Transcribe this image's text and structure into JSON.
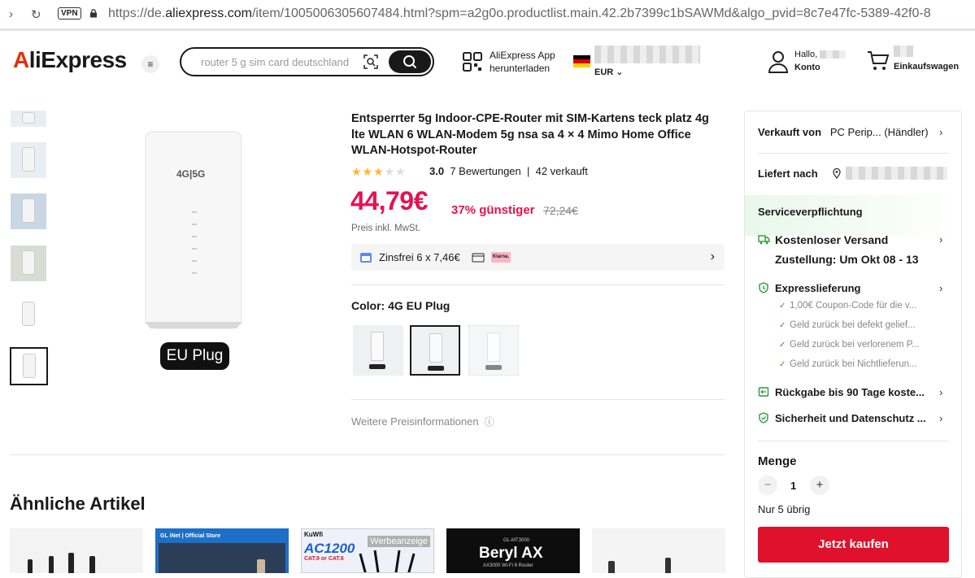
{
  "browser": {
    "vpn_label": "VPN",
    "url_prefix": "https://de.",
    "url_domain": "aliexpress.com",
    "url_rest": "/item/1005006305607484.html?spm=a2g0o.productlist.main.42.2b7399c1bSAWMd&algo_pvid=8c7e47fc-5389-42f0-8"
  },
  "header": {
    "logo": "AliExpress",
    "search_placeholder": "router 5 g sim card deutschland",
    "app_line1": "AliExpress App",
    "app_line2": "herunterladen",
    "currency": "EUR",
    "hello": "Hallo,",
    "account": "Konto",
    "cart": "Einkaufswagen"
  },
  "gallery": {
    "main_badge": "EU Plug"
  },
  "product": {
    "title": "Entsperrter 5g Indoor-CPE-Router mit SIM-Kartens teck platz 4g lte WLAN 6 WLAN-Modem 5g nsa sa 4 × 4 Mimo Home Office WLAN-Hotspot-Router",
    "rating": "3.0",
    "reviews": "7 Bewertungen",
    "sold": "42 verkauft",
    "price": "44,79€",
    "discount": "37% günstiger",
    "old_price": "72,24€",
    "tax_note": "Preis inkl. MwSt.",
    "installment": "Zinsfrei 6 x 7,46€",
    "klarna": "Klarna.",
    "color_label": "Color: 4G EU Plug",
    "more_info": "Weitere Preisinformationen"
  },
  "panel": {
    "sold_by_label": "Verkauft von",
    "sold_by_value": "PC Perip... (Händler)",
    "ship_to_label": "Liefert nach",
    "service_heading": "Serviceverpflichtung",
    "free_shipping": "Kostenloser Versand",
    "delivery": "Zustellung: Um Okt 08 - 13",
    "express": "Expresslieferung",
    "express_items": [
      "1,00€ Coupon-Code für die v...",
      "Geld zurück bei defekt gelief...",
      "Geld zurück bei verlorenem P...",
      "Geld zurück bei Nichtlieferun..."
    ],
    "returns": "Rückgabe bis 90 Tage koste...",
    "security": "Sicherheit und Datenschutz ...",
    "qty_label": "Menge",
    "qty_value": "1",
    "stock": "Nur 5 übrig",
    "buy_now": "Jetzt kaufen"
  },
  "similar": {
    "title": "Ähnliche Artikel",
    "card2_store": "GL iNet | Official Store",
    "card3_brand": "KuWfi",
    "card3_model": "AC1200",
    "card3_sub": "CAT.9 or CAT.6",
    "card3_ad": "Werbeanzeige",
    "card4_code": "GL-MT3000",
    "card4_brand": "Beryl AX",
    "card4_sub": "AX3000 Wi-Fi 6 Router"
  },
  "colors": {
    "brand_red": "#e62e04",
    "price_red": "#e5124f",
    "buy_red": "#e0112c",
    "star": "#fdb82b",
    "service_green": "#2d9a3a"
  }
}
